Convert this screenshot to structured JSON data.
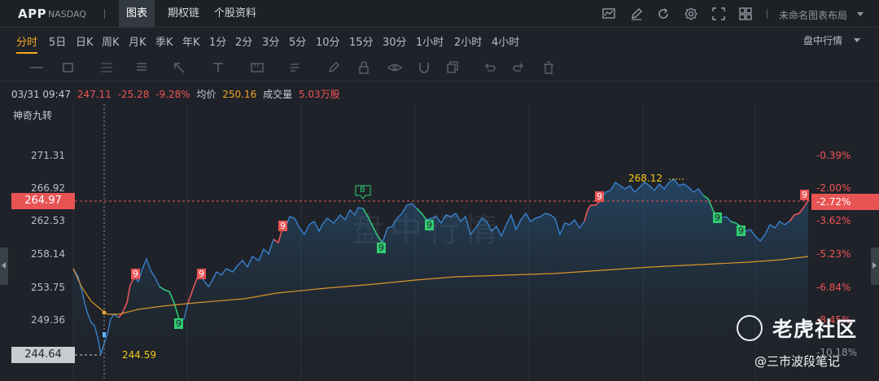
{
  "header": {
    "ticker": "APP",
    "exchange": "NASDAQ",
    "tabs": [
      {
        "label": "图表",
        "active": true
      },
      {
        "label": "期权链",
        "active": false
      },
      {
        "label": "个股资料",
        "active": false
      }
    ],
    "toolbar_icons": [
      "chart-type-icon",
      "draw-icon",
      "refresh-icon",
      "settings-icon",
      "fullscreen-icon",
      "layout-grid-icon"
    ],
    "layout_name": "未命名图表布局"
  },
  "periods": {
    "items": [
      "分时",
      "5日",
      "日K",
      "周K",
      "月K",
      "季K",
      "年K",
      "1分",
      "2分",
      "3分",
      "5分",
      "10分",
      "15分",
      "30分",
      "1小时",
      "2小时",
      "4小时"
    ],
    "active": "分时",
    "mode_select": "盘中行情"
  },
  "draw_tools": [
    "line-tool-icon",
    "rectangle-tool-icon",
    "fibonacci-tool-icon",
    "text-list-tool-icon",
    "arrow-tool-icon",
    "text-tool-icon",
    "measure-tool-icon",
    "brush-tool-icon",
    "lock-icon",
    "eye-icon",
    "magnet-icon",
    "copy-icon",
    "undo-icon",
    "redo-icon",
    "trash-icon"
  ],
  "info": {
    "datetime": "03/31 09:47",
    "price": "247.11",
    "change": "-25.28",
    "change_pct": "-9.28%",
    "avg_label": "均价",
    "avg_value": "250.16",
    "volume_label": "成交量",
    "volume_value": "5.03万股"
  },
  "indicator": "神奇九转",
  "y_axis_left": [
    "271.31",
    "266.92",
    "262.53",
    "258.14",
    "253.75",
    "249.36",
    "244.64"
  ],
  "y_axis_right": [
    "-0.39%",
    "-2.00%",
    "-3.62%",
    "-5.23%",
    "-6.84%",
    "-8.45%",
    "-10.18%"
  ],
  "current_price": "264.97",
  "current_pct": "-2.72%",
  "low_price_box": "244.64",
  "annotations": {
    "high": "268.12",
    "low": "244.59",
    "buy_marker": "B",
    "nine": "9"
  },
  "background_watermark": "盘中行情",
  "watermark": {
    "brand": "老虎社区",
    "author": "@三市波段笔记"
  },
  "colors": {
    "up": "#f05252",
    "down": "#2ecc71",
    "avg": "#f5a623",
    "price_line": "#3a86d8",
    "accent": "#f5a623"
  }
}
